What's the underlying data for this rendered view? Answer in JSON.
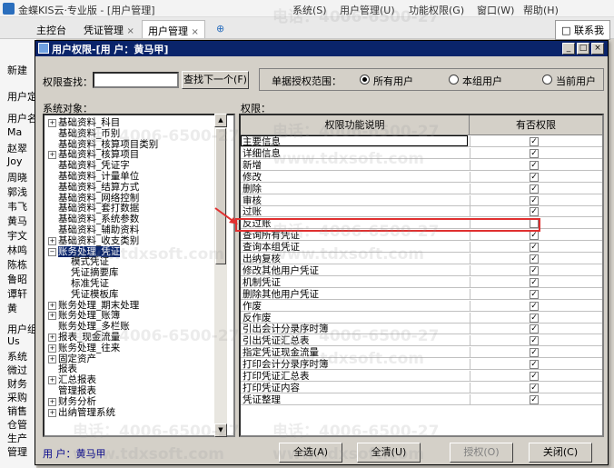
{
  "app": {
    "title": "金蝶KIS云·专业版 - [用户管理]",
    "menus": [
      "系统(S)",
      "用户管理(U)",
      "功能权限(G)",
      "窗口(W)",
      "帮助(H)"
    ],
    "tabs": [
      {
        "label": "主控台"
      },
      {
        "label": "凭证管理",
        "close": "×"
      },
      {
        "label": "用户管理",
        "close": "×"
      }
    ],
    "add_tab": "⊕",
    "contact": "□ 联系我",
    "left_fragments": [
      "新建",
      "用户定",
      "用户名",
      "Ma",
      "赵翠",
      "Joy",
      "周晓",
      "郭浅",
      "韦飞",
      "黄马",
      "宇文",
      "林鸣",
      "陈栋",
      "鲁昭",
      "谭轩",
      "黄",
      "用户组",
      "Us",
      "系统",
      "微过",
      "财务",
      "采购",
      "销售",
      "仓管",
      "生产",
      "管理"
    ]
  },
  "watermarks": [
    "电话：4006-6500-27",
    "www.tdxsoft.com"
  ],
  "dialog": {
    "title": "用户权限-[用 户：黄马甲]",
    "search_label": "权限查找：",
    "search_value": "",
    "find_next": "查找下一个(F)",
    "scope_label": "单据授权范围：",
    "scope_options": [
      {
        "label": "所有用户",
        "selected": true
      },
      {
        "label": "本组用户",
        "selected": false
      },
      {
        "label": "当前用户",
        "selected": false
      }
    ],
    "objects_label": "系统对象：",
    "perm_label": "权限：",
    "tree": [
      {
        "label": "基础资料_科目",
        "indent": 0,
        "plus": true
      },
      {
        "label": "基础资料_币别",
        "indent": 0,
        "plus": false
      },
      {
        "label": "基础资料_核算项目类别",
        "indent": 0,
        "plus": false
      },
      {
        "label": "基础资料_核算项目",
        "indent": 0,
        "plus": true
      },
      {
        "label": "基础资料_凭证字",
        "indent": 0,
        "plus": false
      },
      {
        "label": "基础资料_计量单位",
        "indent": 0,
        "plus": false
      },
      {
        "label": "基础资料_结算方式",
        "indent": 0,
        "plus": false
      },
      {
        "label": "基础资料_网络控制",
        "indent": 0,
        "plus": false
      },
      {
        "label": "基础资料_套打数据",
        "indent": 0,
        "plus": false
      },
      {
        "label": "基础资料_系统参数",
        "indent": 0,
        "plus": false
      },
      {
        "label": "基础资料_辅助资料",
        "indent": 0,
        "plus": false
      },
      {
        "label": "基础资料_收支类别",
        "indent": 0,
        "plus": true
      },
      {
        "label": "账务处理_凭证",
        "indent": 0,
        "plus": true,
        "expanded": true,
        "selected": true
      },
      {
        "label": "模式凭证",
        "indent": 1,
        "plus": false
      },
      {
        "label": "凭证摘要库",
        "indent": 1,
        "plus": false
      },
      {
        "label": "标准凭证",
        "indent": 1,
        "plus": false
      },
      {
        "label": "凭证模板库",
        "indent": 1,
        "plus": false
      },
      {
        "label": "账务处理_期末处理",
        "indent": 0,
        "plus": true
      },
      {
        "label": "账务处理_账簿",
        "indent": 0,
        "plus": true
      },
      {
        "label": "账务处理_多栏账",
        "indent": 0,
        "plus": false
      },
      {
        "label": "报表_现金流量",
        "indent": 0,
        "plus": true
      },
      {
        "label": "账务处理_往来",
        "indent": 0,
        "plus": true
      },
      {
        "label": "固定资产",
        "indent": 0,
        "plus": true
      },
      {
        "label": "报表",
        "indent": 0,
        "plus": false
      },
      {
        "label": "汇总报表",
        "indent": 0,
        "plus": true
      },
      {
        "label": "管理报表",
        "indent": 0,
        "plus": false
      },
      {
        "label": "财务分析",
        "indent": 0,
        "plus": true
      },
      {
        "label": "出纳管理系统",
        "indent": 0,
        "plus": true
      }
    ],
    "grid_headers": [
      "权限功能说明",
      "有否权限"
    ],
    "permissions": [
      {
        "name": "主要信息",
        "checked": true
      },
      {
        "name": "详细信息",
        "checked": true
      },
      {
        "name": "新增",
        "checked": true
      },
      {
        "name": "修改",
        "checked": true
      },
      {
        "name": "删除",
        "checked": true
      },
      {
        "name": "审核",
        "checked": true
      },
      {
        "name": "过账",
        "checked": true
      },
      {
        "name": "反过账",
        "checked": false
      },
      {
        "name": "查询所有凭证",
        "checked": true
      },
      {
        "name": "查询本组凭证",
        "checked": true
      },
      {
        "name": "出纳复核",
        "checked": true
      },
      {
        "name": "修改其他用户凭证",
        "checked": true
      },
      {
        "name": "机制凭证",
        "checked": true
      },
      {
        "name": "删除其他用户凭证",
        "checked": true
      },
      {
        "name": "作废",
        "checked": true
      },
      {
        "name": "反作废",
        "checked": true
      },
      {
        "name": "引出会计分录序时簿",
        "checked": true
      },
      {
        "name": "引出凭证汇总表",
        "checked": true
      },
      {
        "name": "指定凭证现金流量",
        "checked": true
      },
      {
        "name": "打印会计分录序时簿",
        "checked": true
      },
      {
        "name": "打印凭证汇总表",
        "checked": true
      },
      {
        "name": "打印凭证内容",
        "checked": true
      },
      {
        "name": "凭证整理",
        "checked": true
      }
    ],
    "user_label": "用 户：黄马甲",
    "buttons": [
      {
        "label": "全选(A)",
        "disabled": false
      },
      {
        "label": "全清(U)",
        "disabled": false
      },
      {
        "label": "授权(O)",
        "disabled": true
      },
      {
        "label": "关闭(C)",
        "disabled": false
      }
    ],
    "check_glyph": "✓",
    "highlight_color": "#e03030"
  }
}
